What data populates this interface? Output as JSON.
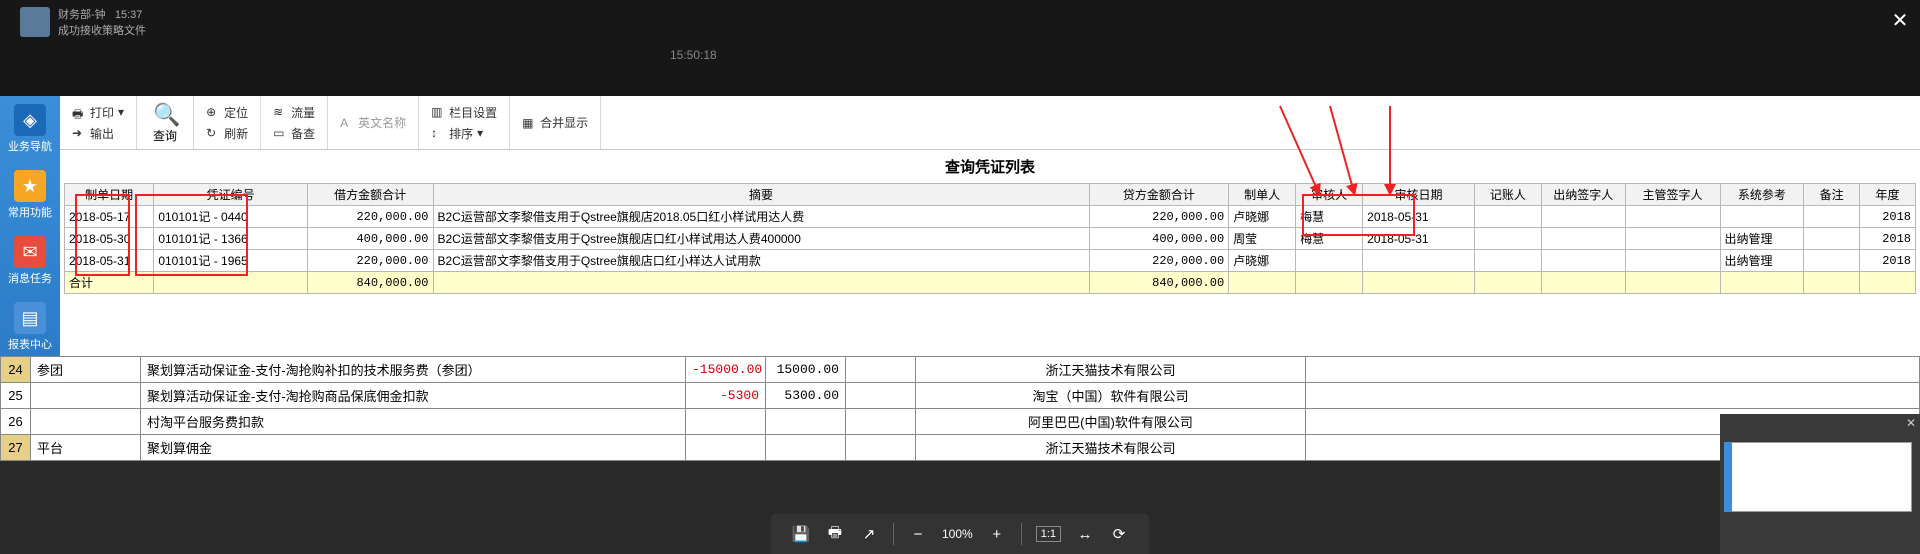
{
  "dim": {
    "chat1_name": "财务部-钟",
    "chat1_time": "15:37",
    "chat1_sub": "成功接收策略文件",
    "clock": "15:50:18"
  },
  "nav": {
    "compass": "业务导航",
    "star": "常用功能",
    "mail": "消息任务",
    "report": "报表中心"
  },
  "ribbon": {
    "print": "打印",
    "export": "输出",
    "query": "查询",
    "locate": "定位",
    "refresh": "刷新",
    "flow": "流量",
    "remark": "备查",
    "english": "英文名称",
    "col_set": "栏目设置",
    "sort": "排序",
    "merge": "合并显示"
  },
  "title": "查询凭证列表",
  "cols": {
    "date": "制单日期",
    "vno": "凭证编号",
    "debit": "借方金额合计",
    "summary": "摘要",
    "credit": "贷方金额合计",
    "maker": "制单人",
    "reviewer": "审核人",
    "review_date": "审核日期",
    "poster": "记账人",
    "cashier": "出纳签字人",
    "supervisor": "主管签字人",
    "sysref": "系统参考",
    "remark": "备注",
    "year": "年度"
  },
  "rows": [
    {
      "date": "2018-05-17",
      "vno": "010101记 - 0440",
      "debit": "220,000.00",
      "summary": "B2C运营部文李黎借支用于Qstree旗舰店2018.05口红小样试用达人费",
      "credit": "220,000.00",
      "maker": "卢晓娜",
      "reviewer": "梅慧",
      "rdate": "2018-05-31",
      "poster": "",
      "cashier": "",
      "supervisor": "",
      "sysref": "",
      "remark": "",
      "year": "2018"
    },
    {
      "date": "2018-05-30",
      "vno": "010101记 - 1366",
      "debit": "400,000.00",
      "summary": "B2C运营部文李黎借支用于Qstree旗舰店口红小样试用达人费400000",
      "credit": "400,000.00",
      "maker": "周莹",
      "reviewer": "梅慧",
      "rdate": "2018-05-31",
      "poster": "",
      "cashier": "",
      "supervisor": "",
      "sysref": "出纳管理",
      "remark": "",
      "year": "2018"
    },
    {
      "date": "2018-05-31",
      "vno": "010101记 - 1965",
      "debit": "220,000.00",
      "summary": "B2C运营部文李黎借支用于Qstree旗舰店口红小样达人试用款",
      "credit": "220,000.00",
      "maker": "卢晓娜",
      "reviewer": "",
      "rdate": "",
      "poster": "",
      "cashier": "",
      "supervisor": "",
      "sysref": "出纳管理",
      "remark": "",
      "year": "2018"
    }
  ],
  "total": {
    "label": "合计",
    "debit": "840,000.00",
    "credit": "840,000.00"
  },
  "bg": {
    "r1_no": "24",
    "r1_tag": "参团",
    "r1_desc": "聚划算活动保证金-支付-淘抢购补扣的技术服务费（参团）",
    "r1_d": "-15000.00",
    "r1_c": "15000.00",
    "r1_co": "浙江天猫技术有限公司",
    "r2_no": "25",
    "r2_desc": "聚划算活动保证金-支付-淘抢购商品保底佣金扣款",
    "r2_d": "-5300",
    "r2_c": "5300.00",
    "r2_co": "淘宝（中国）软件有限公司",
    "r3_no": "26",
    "r3_desc": "村淘平台服务费扣款",
    "r3_co": "阿里巴巴(中国)软件有限公司",
    "r4_no": "27",
    "r4_tag": "平台",
    "r4_desc": "聚划算佣金",
    "r4_co": "浙江天猫技术有限公司"
  },
  "pdf": {
    "zoom": "100%",
    "fit": "1:1"
  }
}
